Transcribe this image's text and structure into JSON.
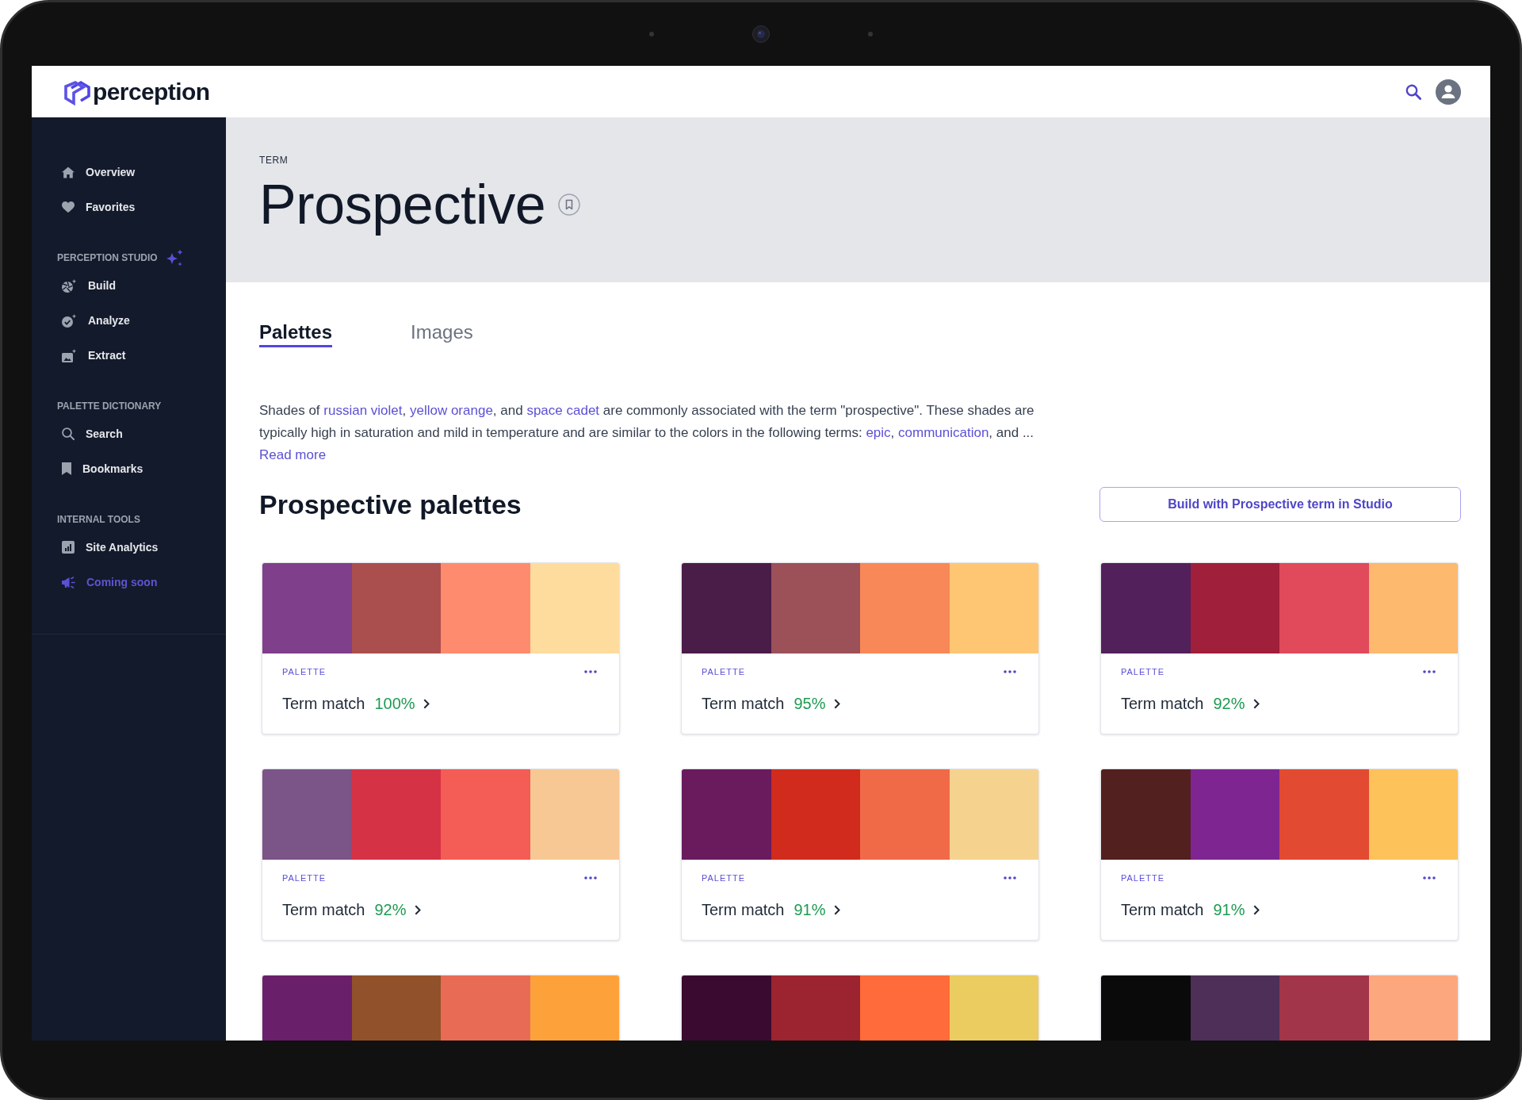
{
  "header": {
    "logo_text": "perception"
  },
  "sidebar": {
    "sections": [
      {
        "items": [
          {
            "label": "Overview",
            "kind": "link"
          },
          {
            "label": "Favorites",
            "kind": "link"
          }
        ]
      },
      {
        "heading": "PERCEPTION STUDIO",
        "items": [
          {
            "label": "Build",
            "kind": "link"
          },
          {
            "label": "Analyze",
            "kind": "link"
          },
          {
            "label": "Extract",
            "kind": "link"
          }
        ]
      },
      {
        "heading": "PALETTE DICTIONARY",
        "items": [
          {
            "label": "Search",
            "kind": "link"
          },
          {
            "label": "Bookmarks",
            "kind": "link"
          }
        ]
      },
      {
        "heading": "INTERNAL TOOLS",
        "items": [
          {
            "label": "Site Analytics",
            "kind": "link"
          },
          {
            "label": "Coming soon",
            "kind": "teaser"
          }
        ]
      }
    ]
  },
  "term": {
    "eyebrow": "TERM",
    "title": "Prospective"
  },
  "tabs": [
    {
      "label": "Palettes",
      "selected": true
    },
    {
      "label": "Images",
      "selected": false
    }
  ],
  "description": {
    "segments": [
      {
        "kind": "text",
        "text": "Shades of "
      },
      {
        "kind": "link",
        "text": "russian violet"
      },
      {
        "kind": "text",
        "text": ", "
      },
      {
        "kind": "link",
        "text": "yellow orange"
      },
      {
        "kind": "text",
        "text": ", and "
      },
      {
        "kind": "link",
        "text": "space cadet"
      },
      {
        "kind": "text",
        "text": " are commonly associated with the term \"prospective\". These shades are typically high in saturation and mild in temperature and are similar to the colors in the following terms: "
      },
      {
        "kind": "link",
        "text": "epic"
      },
      {
        "kind": "text",
        "text": ", "
      },
      {
        "kind": "link",
        "text": "communication"
      },
      {
        "kind": "text",
        "text": ", and ..."
      }
    ],
    "read_more": "Read more"
  },
  "palettes": {
    "title": "Prospective palettes",
    "button": "Build with Prospective term in Studio",
    "cards": [
      {
        "swatches": [
          {
            "color": "#7f3f8a"
          },
          {
            "color": "#aa4f4e"
          },
          {
            "color": "#ff8b6e"
          },
          {
            "color": "#fddc9e"
          }
        ],
        "label": "PALETTE",
        "match_label": "Term match",
        "match": "100%"
      },
      {
        "swatches": [
          {
            "color": "#4a1c48"
          },
          {
            "color": "#9c5058"
          },
          {
            "color": "#f98858"
          },
          {
            "color": "#fec673"
          }
        ],
        "label": "PALETTE",
        "match_label": "Term match",
        "match": "95%"
      },
      {
        "swatches": [
          {
            "color": "#52215c"
          },
          {
            "color": "#a01f3a"
          },
          {
            "color": "#e04a5a"
          },
          {
            "color": "#fdb96e"
          }
        ],
        "label": "PALETTE",
        "match_label": "Term match",
        "match": "92%"
      },
      {
        "swatches": [
          {
            "color": "#7b5488"
          },
          {
            "color": "#d63246"
          },
          {
            "color": "#f35d55"
          },
          {
            "color": "#f7c893"
          }
        ],
        "label": "PALETTE",
        "match_label": "Term match",
        "match": "92%"
      },
      {
        "swatches": [
          {
            "color": "#6a1b5e"
          },
          {
            "color": "#d12b1d"
          },
          {
            "color": "#f06a48"
          },
          {
            "color": "#f5d38e"
          }
        ],
        "label": "PALETTE",
        "match_label": "Term match",
        "match": "91%"
      },
      {
        "swatches": [
          {
            "color": "#52201e"
          },
          {
            "color": "#7e2592"
          },
          {
            "color": "#e24b32"
          },
          {
            "color": "#fdc25a"
          }
        ],
        "label": "PALETTE",
        "match_label": "Term match",
        "match": "91%"
      },
      {
        "swatches": [
          {
            "color": "#6a1f6a"
          },
          {
            "color": "#91512a"
          },
          {
            "color": "#e86c55"
          },
          {
            "color": "#fda23b"
          }
        ]
      },
      {
        "swatches": [
          {
            "color": "#3a0a30"
          },
          {
            "color": "#9c2430"
          },
          {
            "color": "#ff6b3a"
          },
          {
            "color": "#ebcc60"
          }
        ]
      },
      {
        "swatches": [
          {
            "color": "#0a0a0a"
          },
          {
            "color": "#4d2f58"
          },
          {
            "color": "#a23549"
          },
          {
            "color": "#fca77e"
          }
        ]
      }
    ]
  }
}
